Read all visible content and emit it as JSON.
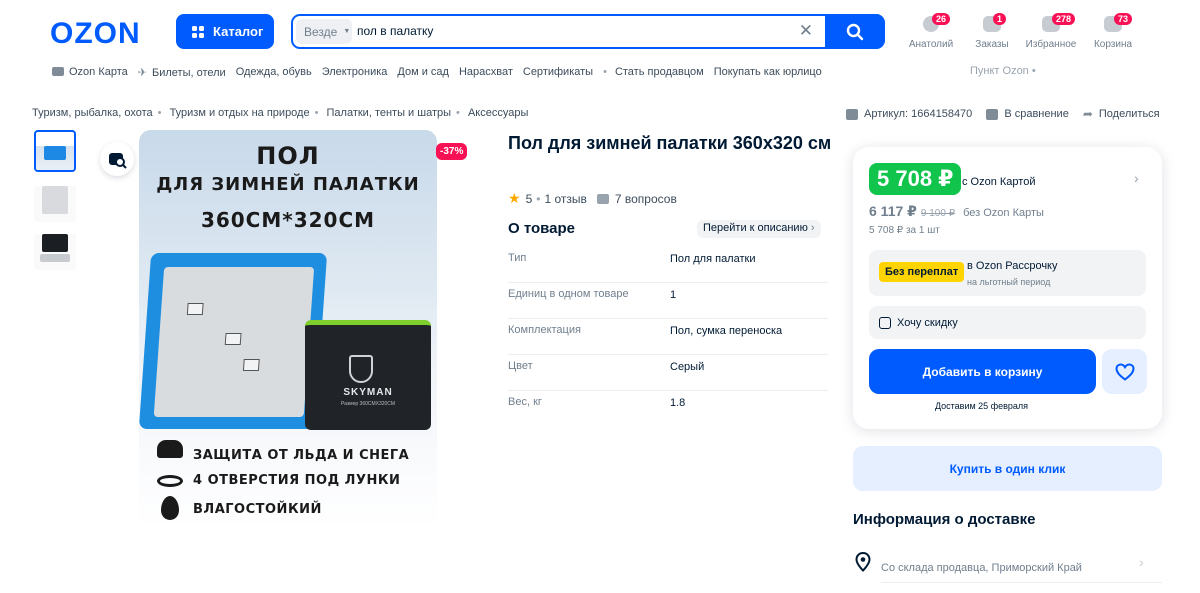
{
  "header": {
    "logo": "OZON",
    "catalog_label": "Каталог",
    "search": {
      "scope": "Везде",
      "query": "пол в палатку"
    },
    "icons": [
      {
        "label": "Анатолий",
        "badge": "26"
      },
      {
        "label": "Заказы",
        "badge": "1"
      },
      {
        "label": "Избранное",
        "badge": "278"
      },
      {
        "label": "Корзина",
        "badge": "73"
      }
    ]
  },
  "subnav": {
    "items": [
      "Ozon Карта",
      "Билеты, отели",
      "Одежда, обувь",
      "Электроника",
      "Дом и сад",
      "Нарасхват",
      "Сертификаты",
      "Стать продавцом",
      "Покупать как юрлицо"
    ],
    "pickup": "Пункт Ozon"
  },
  "breadcrumbs": [
    "Туризм, рыбалка, охота",
    "Туризм и отдых на природе",
    "Палатки, тенты и шатры",
    "Аксессуары"
  ],
  "meta": {
    "article": "Артикул: 1664158470",
    "compare": "В сравнение",
    "share": "Поделиться"
  },
  "image": {
    "discount": "-37%",
    "headline1": "ПОЛ",
    "headline2": "ДЛЯ ЗИМНЕЙ ПАЛАТКИ",
    "headline3": "360СМ*320СМ",
    "brand": "SKYMAN",
    "brand_sub": "Размер 360СМХ320СМ",
    "features": [
      "ЗАЩИТА ОТ ЛЬДА И СНЕГА",
      "4 ОТВЕРСТИЯ ПОД ЛУНКИ",
      "ВЛАГОСТОЙКИЙ"
    ]
  },
  "product": {
    "title": "Пол для зимней палатки 360х320 см",
    "rating": "5",
    "reviews": "1 отзыв",
    "questions": "7 вопросов",
    "about_title": "О товаре",
    "goto_description": "Перейти к описанию",
    "specs": [
      {
        "key": "Тип",
        "value": "Пол для палатки"
      },
      {
        "key": "Единиц в одном товаре",
        "value": "1"
      },
      {
        "key": "Комплектация",
        "value": "Пол, сумка переноска"
      },
      {
        "key": "Цвет",
        "value": "Серый"
      },
      {
        "key": "Вес, кг",
        "value": "1.8"
      }
    ]
  },
  "price_card": {
    "card_price": "5 708 ₽",
    "card_label": "с Ozon Картой",
    "price": "6 117 ₽",
    "old_price": "9 100 ₽",
    "no_card_label": "без Ozon Карты",
    "per_unit": "5 708 ₽ за 1 шт",
    "installment_tag": "Без переплат",
    "installment_title": "в Ozon Рассрочку",
    "installment_sub": "на льготный период",
    "want_discount": "Хочу скидку",
    "add_to_cart": "Добавить в корзину",
    "delivery": "Доставим 25 февраля"
  },
  "buy_one_click": "Купить в один клик",
  "delivery_info": {
    "title": "Информация о доставке",
    "from": "Со склада продавца, Приморский Край"
  },
  "colors": {
    "brand": "#005bff",
    "sale": "#f91155",
    "green": "#10c44c",
    "yellow": "#ffd400"
  }
}
